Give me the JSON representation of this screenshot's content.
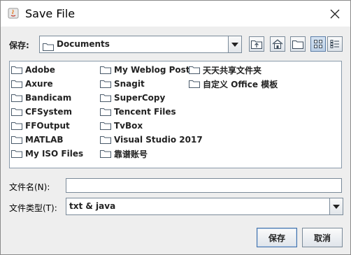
{
  "window": {
    "title": "Save File"
  },
  "save_in": {
    "label": "保存:",
    "value": "Documents"
  },
  "toolbar": {
    "icons": [
      "up-one-level-icon",
      "home-icon",
      "new-folder-icon",
      "list-view-icon",
      "details-view-icon"
    ]
  },
  "files": {
    "col1": [
      "Adobe",
      "Axure",
      "Bandicam",
      "CFSystem",
      "FFOutput",
      "MATLAB",
      "My ISO Files"
    ],
    "col2": [
      "My Weblog Posts",
      "Snagit",
      "SuperCopy",
      "Tencent Files",
      "TvBox",
      "Visual Studio 2017",
      "靠谱账号"
    ],
    "col3": [
      "天天共享文件夹",
      "自定义 Office 模板"
    ]
  },
  "filename": {
    "label": "文件名(N):",
    "value": ""
  },
  "filetype": {
    "label": "文件类型(T):",
    "value": "txt & java"
  },
  "buttons": {
    "save": "保存",
    "cancel": "取消"
  },
  "colors": {
    "folder_fill": "#f4d77a",
    "selection_border": "#3e6ea8"
  }
}
